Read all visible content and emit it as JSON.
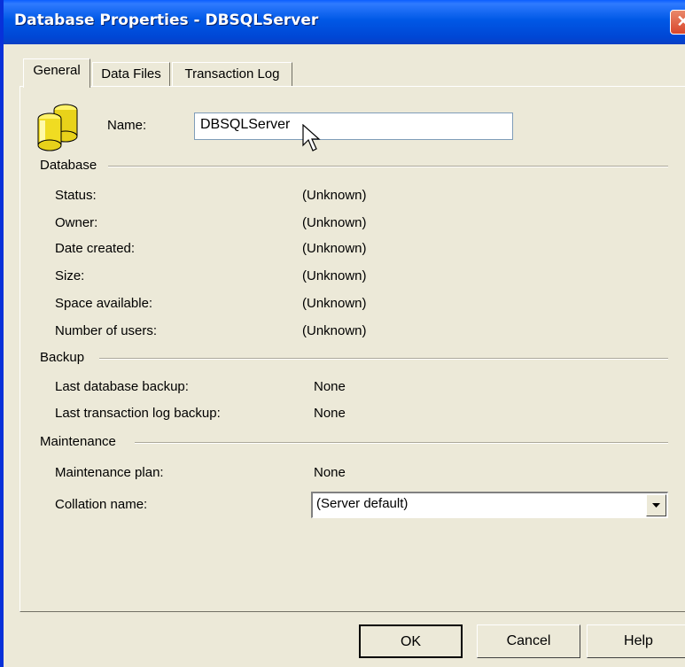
{
  "window": {
    "title": "Database Properties - DBSQLServer",
    "close_glyph": "✕"
  },
  "tabs": [
    {
      "label": "General",
      "active": true
    },
    {
      "label": "Data Files",
      "active": false
    },
    {
      "label": "Transaction Log",
      "active": false
    }
  ],
  "name_field": {
    "label": "Name:",
    "value": "DBSQLServer"
  },
  "database": {
    "title": "Database",
    "rows": [
      {
        "label": "Status:",
        "value": "(Unknown)"
      },
      {
        "label": "Owner:",
        "value": "(Unknown)"
      },
      {
        "label": "Date created:",
        "value": "(Unknown)"
      },
      {
        "label": "Size:",
        "value": "(Unknown)"
      },
      {
        "label": "Space available:",
        "value": "(Unknown)"
      },
      {
        "label": "Number of users:",
        "value": "(Unknown)"
      }
    ]
  },
  "backup": {
    "title": "Backup",
    "rows": [
      {
        "label": "Last database backup:",
        "value": "None"
      },
      {
        "label": "Last transaction log backup:",
        "value": "None"
      }
    ]
  },
  "maintenance": {
    "title": "Maintenance",
    "plan_label": "Maintenance plan:",
    "plan_value": "None",
    "collation_label": "Collation name:",
    "collation_value": "(Server default)"
  },
  "buttons": {
    "ok": "OK",
    "cancel": "Cancel",
    "help": "Help"
  },
  "icons": {
    "database": "database-icon",
    "cursor": "mouse-pointer-icon",
    "dropdown": "chevron-down-icon"
  },
  "colors": {
    "title_bar": "#0058e6",
    "dialog_bg": "#ece9d8",
    "close_button": "#d9462b"
  }
}
